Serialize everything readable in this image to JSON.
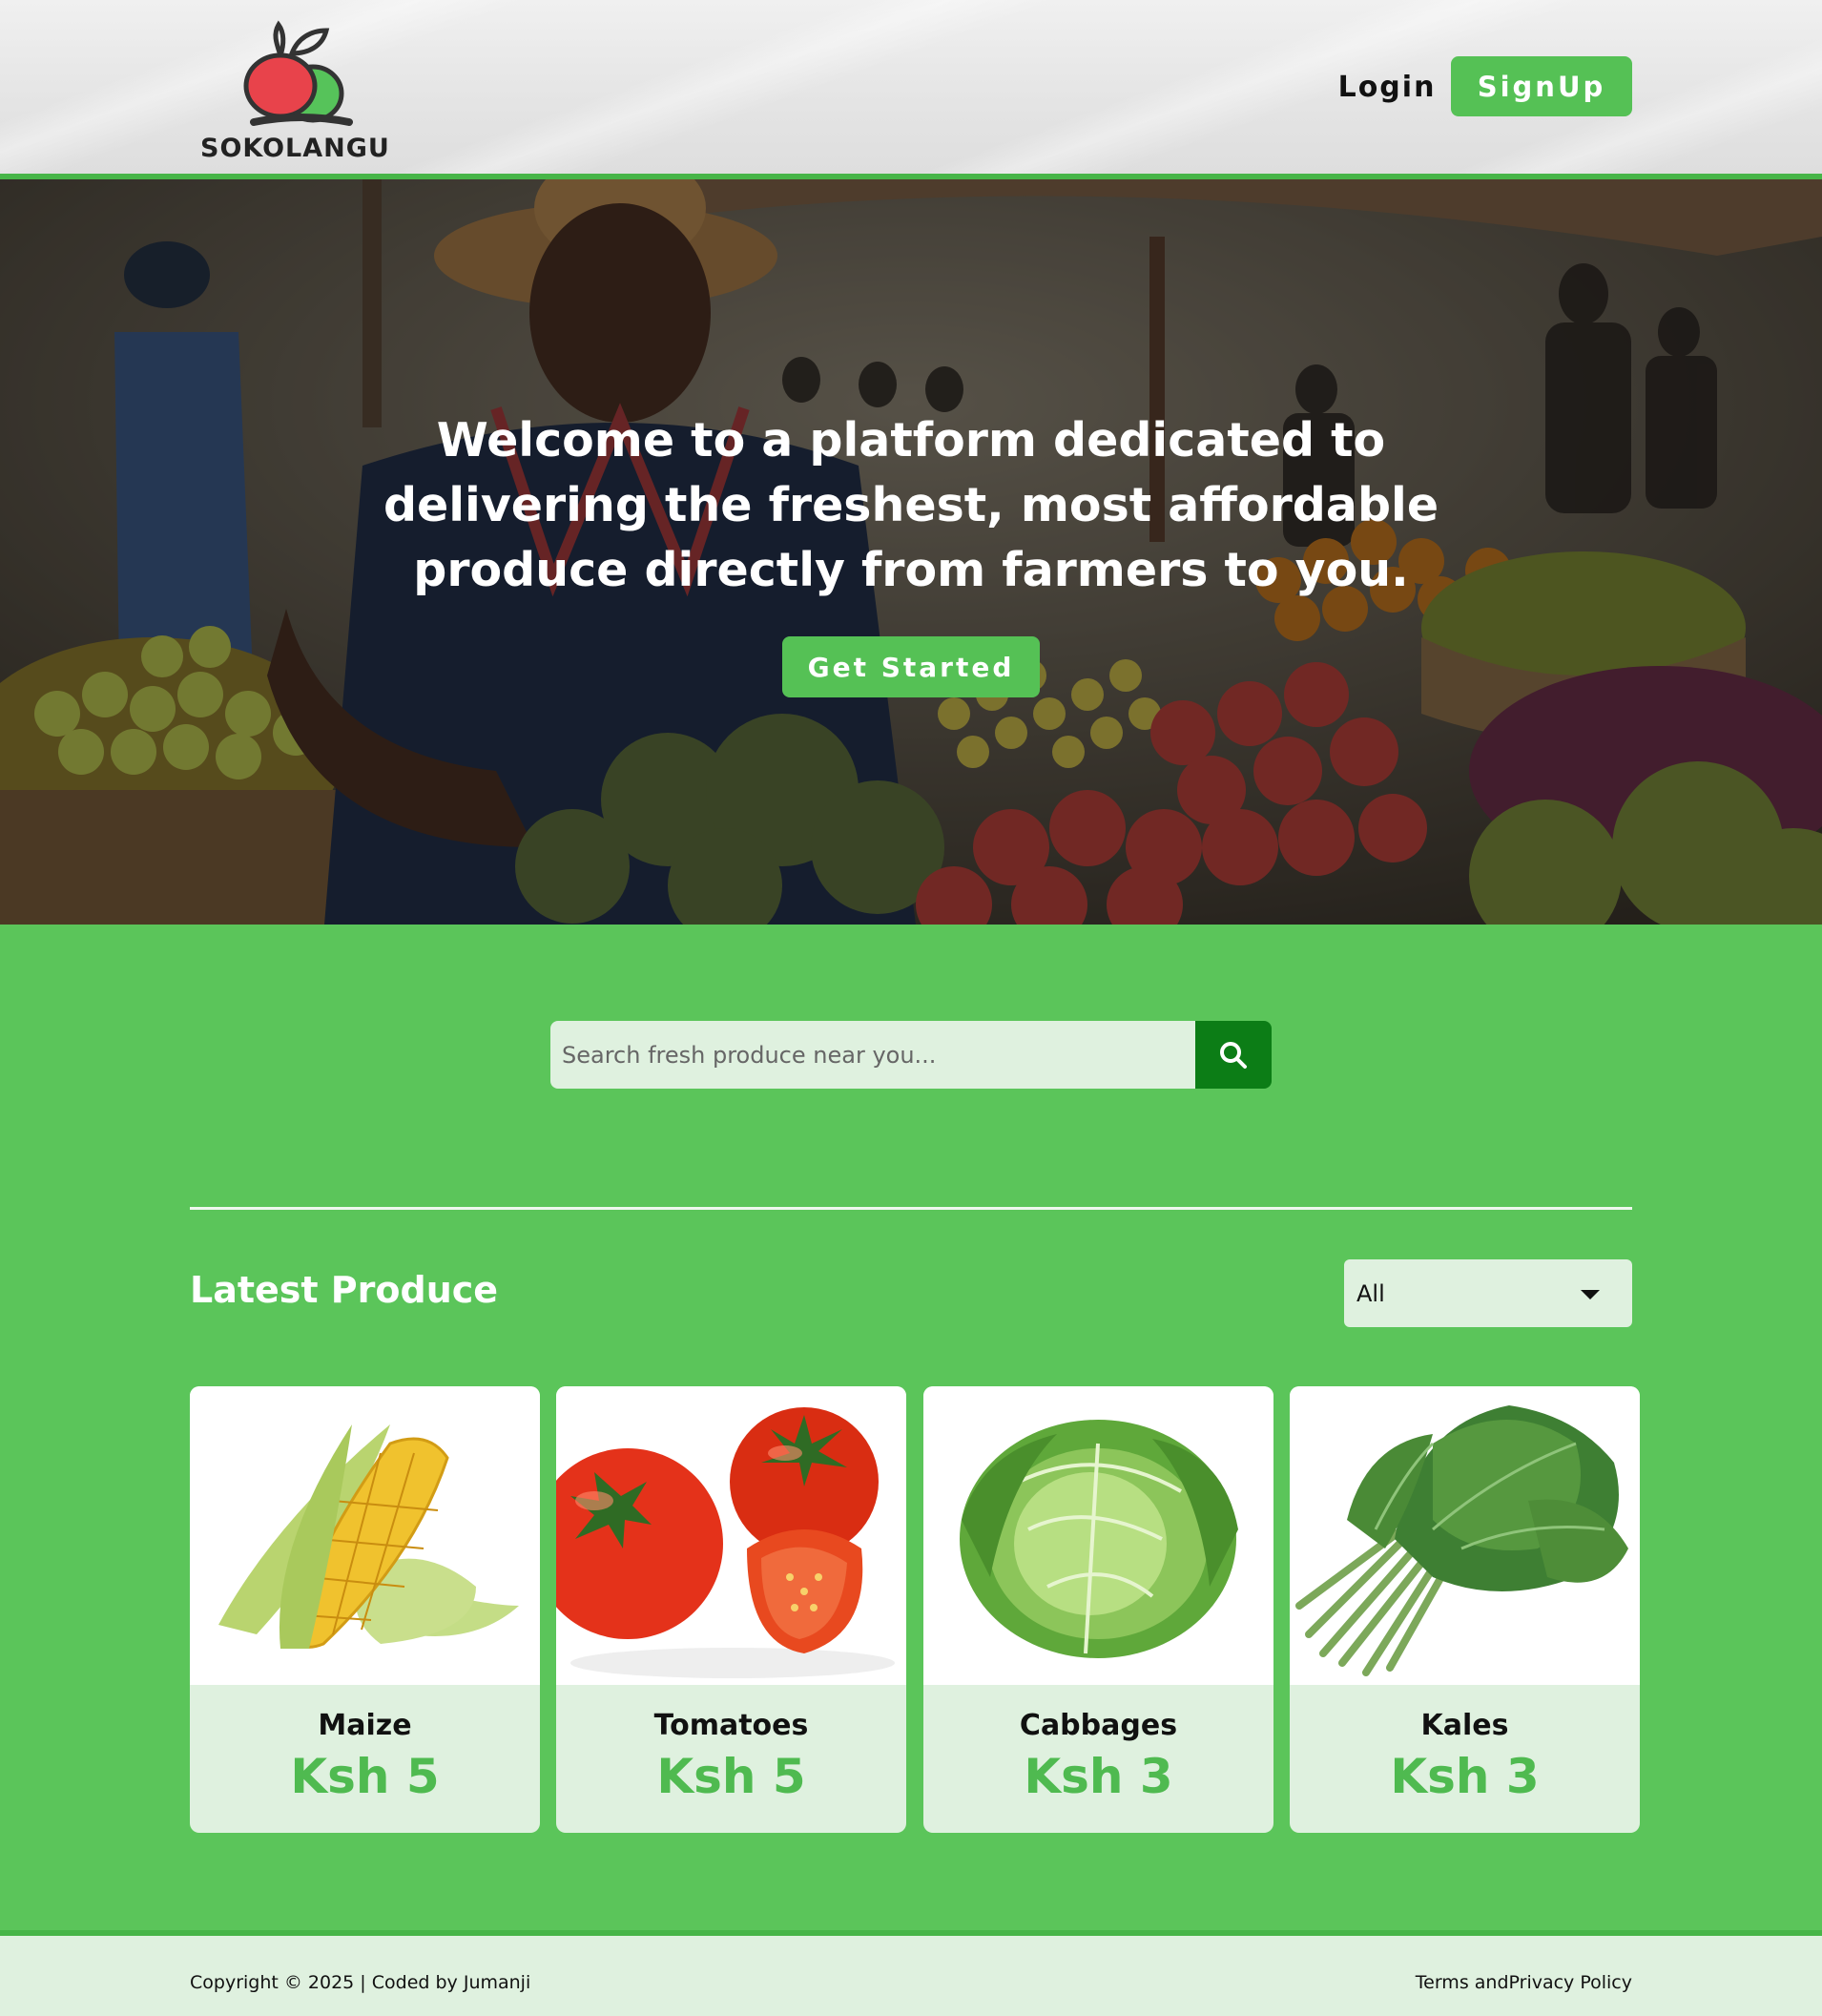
{
  "brand": {
    "name": "SOKOLANGU"
  },
  "header": {
    "login_label": "Login",
    "signup_label": "SignUp"
  },
  "hero": {
    "headline": "Welcome to a platform dedicated to delivering the freshest, most affordable produce directly from farmers to you.",
    "cta_label": "Get Started"
  },
  "search": {
    "placeholder": "Search fresh produce near you...",
    "icon": "search-icon"
  },
  "produce_section": {
    "title": "Latest Produce",
    "filter_selected": "All",
    "items": [
      {
        "name": "Maize",
        "price": "Ksh 5"
      },
      {
        "name": "Tomatoes",
        "price": "Ksh 5"
      },
      {
        "name": "Cabbages",
        "price": "Ksh 3"
      },
      {
        "name": "Kales",
        "price": "Ksh 3"
      }
    ]
  },
  "footer": {
    "copyright": "Copyright © 2025 | Coded by Jumanji",
    "terms": "Terms andPrivacy Policy"
  },
  "colors": {
    "accent": "#55c155",
    "page_bg": "#5bc55a",
    "dark_green": "#0c7d16",
    "light_green": "#dff1df"
  }
}
